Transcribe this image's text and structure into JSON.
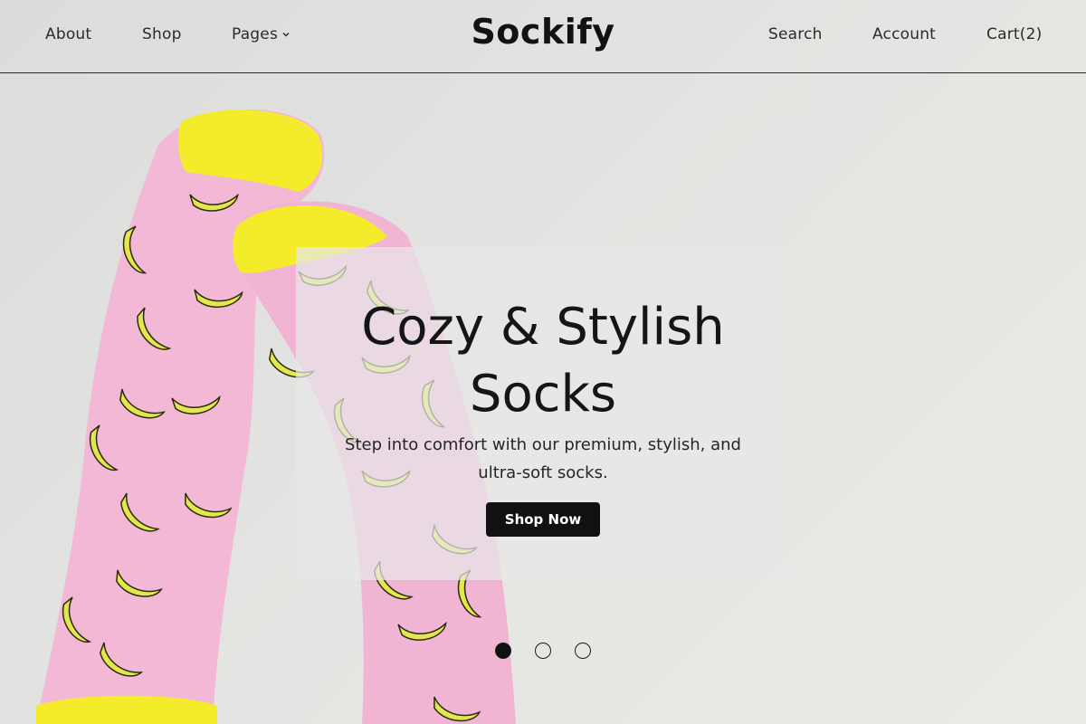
{
  "header": {
    "brand": "Sockify",
    "nav_left": [
      {
        "label": "About"
      },
      {
        "label": "Shop"
      },
      {
        "label": "Pages",
        "icon": "chevron-down-icon"
      }
    ],
    "nav_right": [
      {
        "label": "Search"
      },
      {
        "label": "Account"
      },
      {
        "label": "Cart(2)"
      }
    ]
  },
  "hero": {
    "title_line1": "Cozy & Stylish",
    "title_line2": "Socks",
    "subtitle_line1": "Step into comfort with our premium, stylish, and",
    "subtitle_line2": "ultra-soft socks.",
    "cta_label": "Shop Now",
    "slides": {
      "count": 3,
      "active_index": 0
    }
  },
  "colors": {
    "accent": "#111111",
    "sock_pink": "#f3b8d6",
    "sock_yellow": "#f4ec2a",
    "banana": "#e3e84a"
  }
}
